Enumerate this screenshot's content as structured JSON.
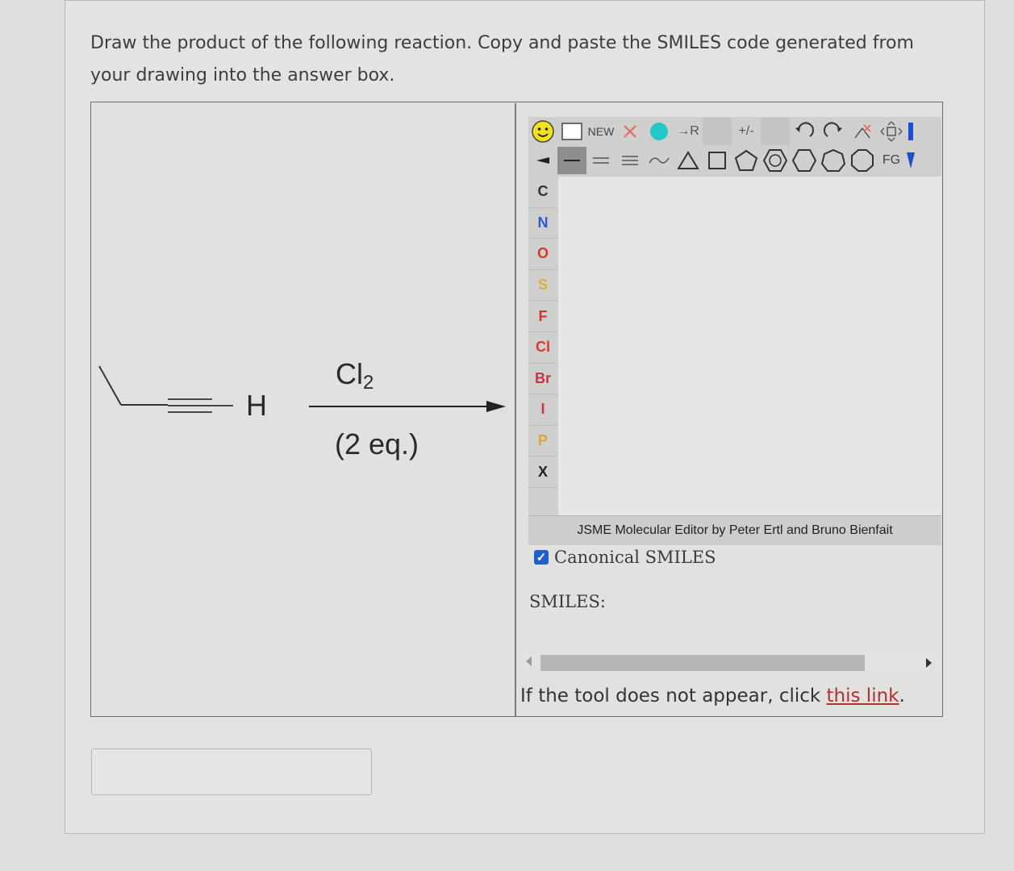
{
  "prompt": {
    "line1": "Draw the product of the following reaction. Copy and paste the SMILES code generated from",
    "line2": "your drawing into the answer box."
  },
  "reaction": {
    "h_label": "H",
    "reagent_main": "Cl",
    "reagent_sub": "2",
    "reagent_eq": "(2 eq.)"
  },
  "jsme": {
    "toolbar_top": [
      "smiley",
      "square",
      "NEW",
      "delete-x",
      "teal-dot",
      "R-group",
      "blank",
      "charge",
      "blank",
      "undo",
      "redo",
      "delete-bond",
      "move"
    ],
    "new_label": "NEW",
    "charge_label": "+/-",
    "rgroup_label": "→R",
    "fg_label": "FG",
    "atoms": [
      "C",
      "N",
      "O",
      "S",
      "F",
      "Cl",
      "Br",
      "I",
      "P",
      "X"
    ],
    "atom_colors": {
      "C": "#333333",
      "N": "#2a5bd7",
      "O": "#d23b2b",
      "S": "#d4b03a",
      "F": "#cc3333",
      "Cl": "#d23b2b",
      "Br": "#cc3344",
      "I": "#cc3344",
      "P": "#e0a040",
      "X": "#222222"
    },
    "credit": "JSME Molecular Editor by Peter Ertl and Bruno Bienfait"
  },
  "options": {
    "canonical_label": "Canonical SMILES",
    "canonical_checked": true
  },
  "smiles": {
    "label": "SMILES:"
  },
  "fallback": {
    "text": "If the tool does not appear, click ",
    "link": "this link",
    "end": "."
  },
  "answer": {
    "value": ""
  }
}
